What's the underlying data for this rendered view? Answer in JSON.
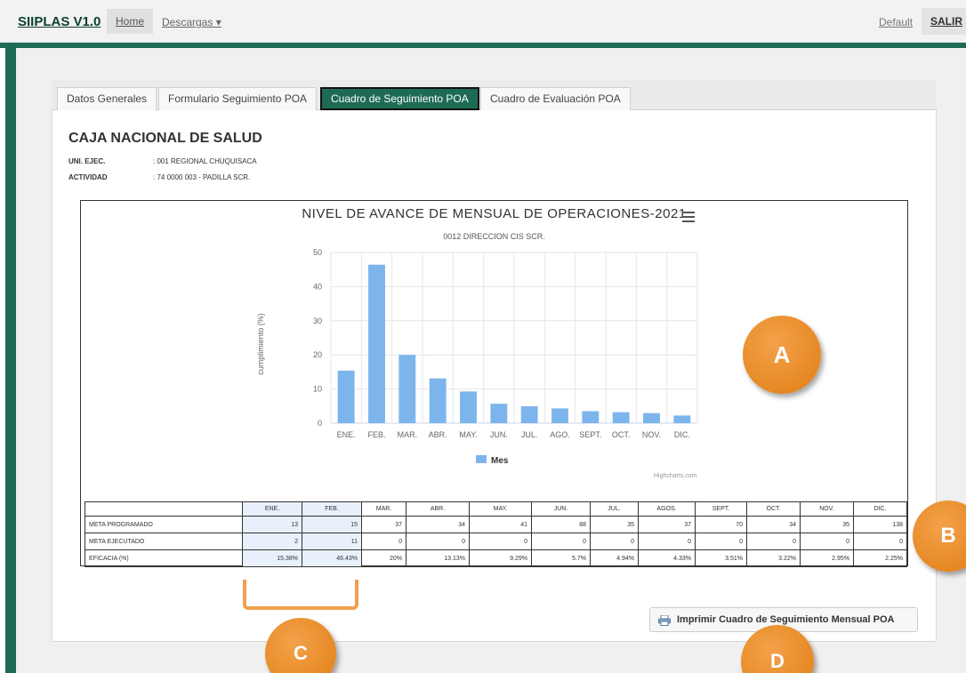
{
  "navbar": {
    "brand": "SIIPLAS V1.0",
    "home": "Home",
    "descargas": "Descargas",
    "default": "Default",
    "salir": "SALIR"
  },
  "tabs": [
    {
      "label": "Datos Generales"
    },
    {
      "label": "Formulario Seguimiento POA"
    },
    {
      "label": "Cuadro de Seguimiento POA"
    },
    {
      "label": "Cuadro de Evaluación POA"
    }
  ],
  "header": {
    "title": "CAJA NACIONAL DE SALUD",
    "uni_label": "UNI. EJEC.",
    "uni_value": ": 001 REGIONAL CHUQUISACA",
    "act_label": "ACTIVIDAD",
    "act_value": ": 74 0000 003 - PADILLA SCR."
  },
  "chart_data": {
    "type": "bar",
    "title": "NIVEL DE AVANCE DE MENSUAL DE OPERACIONES-2021",
    "subtitle": "0012 DIRECCION CIS SCR.",
    "ylabel": "cumplimiento (%)",
    "ylim": [
      0,
      50
    ],
    "yticks": [
      0,
      10,
      20,
      30,
      40,
      50
    ],
    "categories": [
      "ENE.",
      "FEB.",
      "MAR.",
      "ABR.",
      "MAY.",
      "JUN.",
      "JUL.",
      "AGO.",
      "SEPT.",
      "OCT.",
      "NOV.",
      "DIC."
    ],
    "series": [
      {
        "name": "Mes",
        "values": [
          15.38,
          46.43,
          20,
          13.13,
          9.29,
          5.7,
          4.94,
          4.33,
          3.51,
          3.22,
          2.95,
          2.25
        ]
      }
    ],
    "credits": "Highcharts.com",
    "color": "#7cb5ec"
  },
  "table": {
    "headers": [
      "",
      "ENE.",
      "FEB.",
      "MAR.",
      "ABR.",
      "MAY.",
      "JUN.",
      "JUL.",
      "AGOS.",
      "SEPT.",
      "OCT.",
      "NOV.",
      "DIC."
    ],
    "rows": [
      {
        "label": "META PROGRAMADO",
        "values": [
          "13",
          "15",
          "37",
          "34",
          "41",
          "88",
          "35",
          "37",
          "70",
          "34",
          "35",
          "138"
        ]
      },
      {
        "label": "META EJECUTADO",
        "values": [
          "2",
          "11",
          "0",
          "0",
          "0",
          "0",
          "0",
          "0",
          "0",
          "0",
          "0",
          "0"
        ]
      },
      {
        "label": "EFICACIA (%)",
        "values": [
          "15.38%",
          "46.43%",
          "20%",
          "13.13%",
          "9.29%",
          "5.7%",
          "4.94%",
          "4.33%",
          "3.51%",
          "3.22%",
          "2.95%",
          "2.25%"
        ]
      }
    ]
  },
  "print_button": "Imprimir Cuadro de Seguimiento Mensual POA",
  "markers": [
    "A",
    "B",
    "C",
    "D"
  ],
  "colors": {
    "primary": "#1e6b55",
    "marker": "#e8891f"
  }
}
